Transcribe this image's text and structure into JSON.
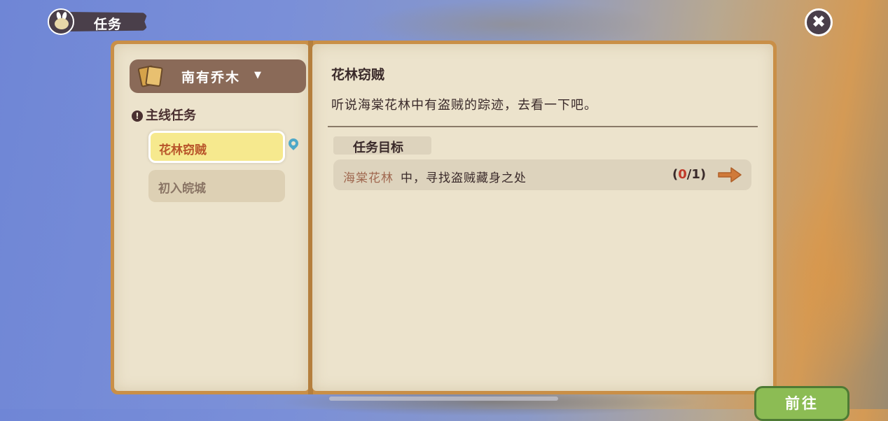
{
  "header": {
    "title": "任务"
  },
  "sidebar": {
    "book_selector": "南有乔木",
    "section_title": "主线任务",
    "tasks": [
      {
        "label": "花林窃贼",
        "active": true
      },
      {
        "label": "初入皖城",
        "active": false
      }
    ]
  },
  "detail": {
    "title": "花林窃贼",
    "description": "听说海棠花林中有盗贼的踪迹，去看一下吧。",
    "objectives_header": "任务目标",
    "objective": {
      "place": "海棠花林",
      "text": "中，寻找盗贼藏身之处",
      "progress_open": "(",
      "current": "0",
      "total_text": "/1)"
    },
    "go_button": "前往"
  },
  "colors": {
    "accent_green": "#8cbc54",
    "panel_brown": "#c98f47",
    "active_task": "#f6e98e"
  }
}
